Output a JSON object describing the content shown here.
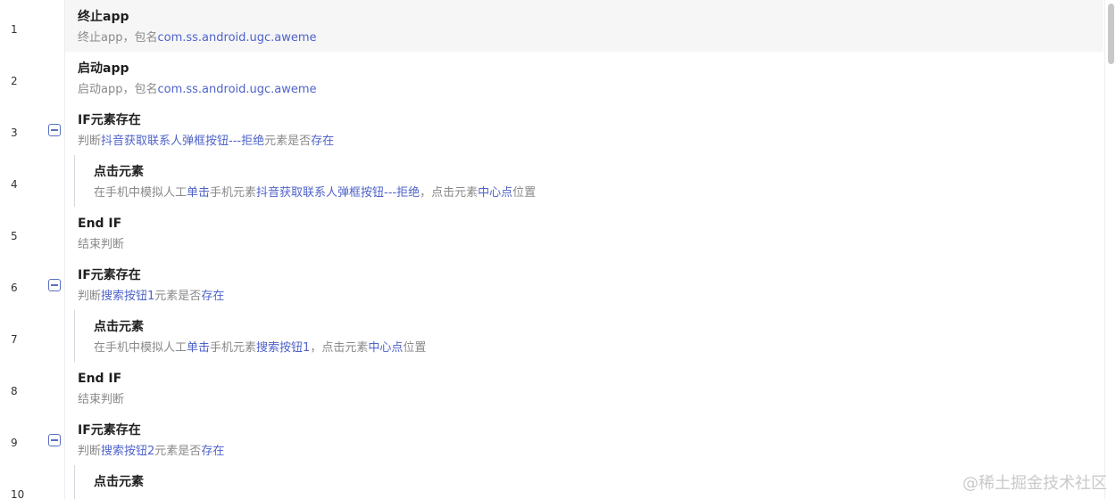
{
  "steps": [
    {
      "line": "1",
      "title": "终止app",
      "desc": [
        {
          "text": "终止app，包名",
          "hl": false
        },
        {
          "text": "com.ss.android.ugc.aweme",
          "hl": true
        }
      ],
      "indent": 0,
      "collapsible": false,
      "selected": true
    },
    {
      "line": "2",
      "title": "启动app",
      "desc": [
        {
          "text": "启动app，包名",
          "hl": false
        },
        {
          "text": "com.ss.android.ugc.aweme",
          "hl": true
        }
      ],
      "indent": 0,
      "collapsible": false,
      "selected": false
    },
    {
      "line": "3",
      "title": "IF元素存在",
      "desc": [
        {
          "text": "判断",
          "hl": false
        },
        {
          "text": "抖音获取联系人弹框按钮---拒绝",
          "hl": true
        },
        {
          "text": "元素是否",
          "hl": false
        },
        {
          "text": "存在",
          "hl": true
        }
      ],
      "indent": 0,
      "collapsible": true,
      "selected": false
    },
    {
      "line": "4",
      "title": "点击元素",
      "desc": [
        {
          "text": "在手机中模拟人工",
          "hl": false
        },
        {
          "text": "单击",
          "hl": true
        },
        {
          "text": "手机元素",
          "hl": false
        },
        {
          "text": "抖音获取联系人弹框按钮---拒绝",
          "hl": true
        },
        {
          "text": "，点击元素",
          "hl": false
        },
        {
          "text": "中心点",
          "hl": true
        },
        {
          "text": "位置",
          "hl": false
        }
      ],
      "indent": 1,
      "collapsible": false,
      "selected": false
    },
    {
      "line": "5",
      "title": "End IF",
      "desc": [
        {
          "text": "结束判断",
          "hl": false
        }
      ],
      "indent": 0,
      "collapsible": false,
      "selected": false
    },
    {
      "line": "6",
      "title": "IF元素存在",
      "desc": [
        {
          "text": "判断",
          "hl": false
        },
        {
          "text": "搜索按钮1",
          "hl": true
        },
        {
          "text": "元素是否",
          "hl": false
        },
        {
          "text": "存在",
          "hl": true
        }
      ],
      "indent": 0,
      "collapsible": true,
      "selected": false
    },
    {
      "line": "7",
      "title": "点击元素",
      "desc": [
        {
          "text": "在手机中模拟人工",
          "hl": false
        },
        {
          "text": "单击",
          "hl": true
        },
        {
          "text": "手机元素",
          "hl": false
        },
        {
          "text": "搜索按钮1",
          "hl": true
        },
        {
          "text": "，点击元素",
          "hl": false
        },
        {
          "text": "中心点",
          "hl": true
        },
        {
          "text": "位置",
          "hl": false
        }
      ],
      "indent": 1,
      "collapsible": false,
      "selected": false
    },
    {
      "line": "8",
      "title": "End IF",
      "desc": [
        {
          "text": "结束判断",
          "hl": false
        }
      ],
      "indent": 0,
      "collapsible": false,
      "selected": false
    },
    {
      "line": "9",
      "title": "IF元素存在",
      "desc": [
        {
          "text": "判断",
          "hl": false
        },
        {
          "text": "搜索按钮2",
          "hl": true
        },
        {
          "text": "元素是否",
          "hl": false
        },
        {
          "text": "存在",
          "hl": true
        }
      ],
      "indent": 0,
      "collapsible": true,
      "selected": false
    },
    {
      "line": "10",
      "title": "点击元素",
      "desc": [],
      "indent": 1,
      "collapsible": false,
      "selected": false
    }
  ],
  "watermark": "@稀土掘金技术社区",
  "colors": {
    "accent": "#3b5bdb",
    "highlight_text": "#4f63c9",
    "muted_text": "#8a8a8a",
    "title_text": "#1f1f1f",
    "selected_row_bg": "#f6f6f7"
  },
  "icons": {
    "collapse": "minus-square-icon"
  }
}
